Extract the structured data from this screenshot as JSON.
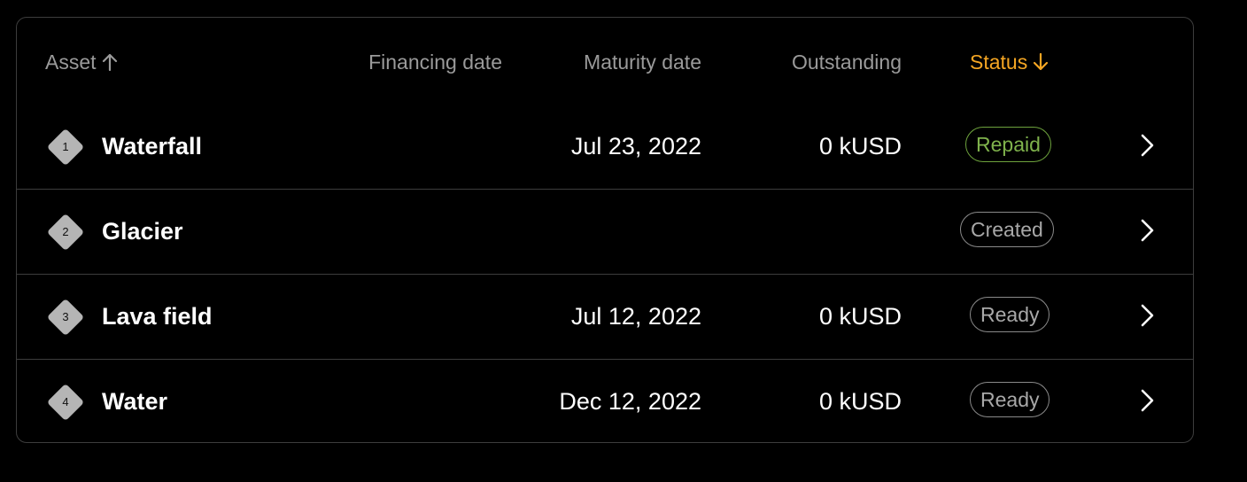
{
  "table": {
    "headers": {
      "asset": "Asset",
      "financing_date": "Financing date",
      "maturity_date": "Maturity date",
      "outstanding": "Outstanding",
      "status": "Status"
    },
    "sort": {
      "asset_direction": "ascending",
      "status_direction": "descending",
      "active_color": "#f5a623"
    },
    "rows": [
      {
        "index": "1",
        "name": "Waterfall",
        "financing_date": "",
        "maturity_date": "Jul 23, 2022",
        "outstanding": "0 kUSD",
        "status": "Repaid",
        "status_color": "#7fb24c"
      },
      {
        "index": "2",
        "name": "Glacier",
        "financing_date": "",
        "maturity_date": "",
        "outstanding": "",
        "status": "Created",
        "status_color": "#a8a8a8"
      },
      {
        "index": "3",
        "name": "Lava field",
        "financing_date": "",
        "maturity_date": "Jul 12, 2022",
        "outstanding": "0 kUSD",
        "status": "Ready",
        "status_color": "#a8a8a8"
      },
      {
        "index": "4",
        "name": "Water",
        "financing_date": "",
        "maturity_date": "Dec 12, 2022",
        "outstanding": "0 kUSD",
        "status": "Ready",
        "status_color": "#a8a8a8"
      }
    ]
  }
}
